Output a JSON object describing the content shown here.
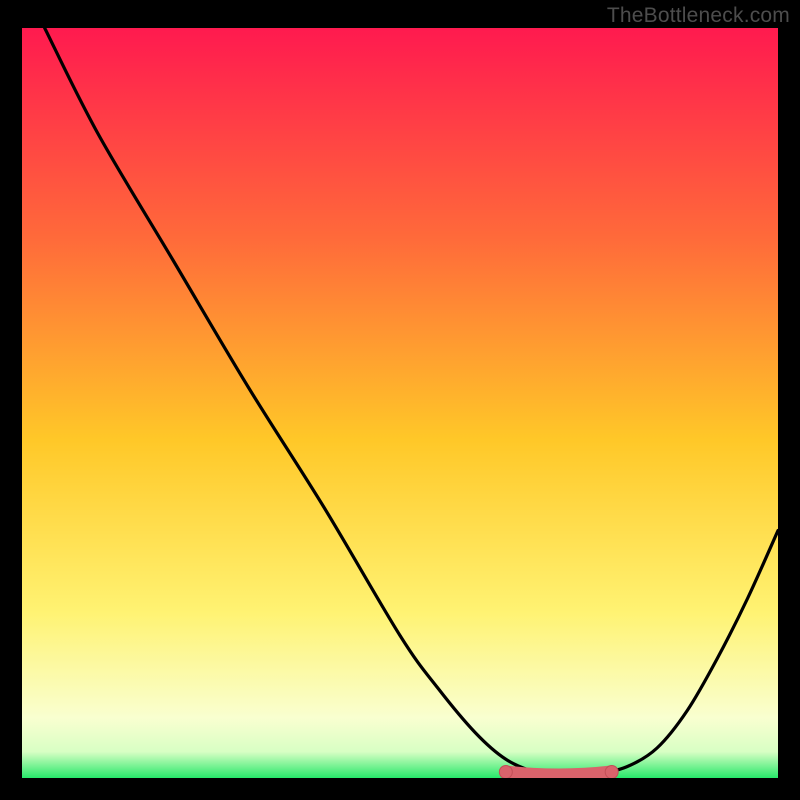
{
  "watermark": "TheBottleneck.com",
  "colors": {
    "black": "#000000",
    "curve": "#000000",
    "marker_fill": "#d9636b",
    "marker_stroke": "#c24f57",
    "grad_top": "#ff1a4f",
    "grad_mid1": "#ff6a3a",
    "grad_mid2": "#ffc828",
    "grad_mid3": "#fff373",
    "grad_mid4": "#f9ffd0",
    "grad_bottom": "#27e86a"
  },
  "chart_data": {
    "type": "line",
    "title": "",
    "xlabel": "",
    "ylabel": "",
    "xlim": [
      0,
      100
    ],
    "ylim": [
      0,
      100
    ],
    "x": [
      3,
      10,
      20,
      30,
      40,
      50,
      55,
      60,
      64,
      68,
      72,
      76,
      80,
      84,
      88,
      92,
      96,
      100
    ],
    "values": [
      100,
      86,
      69,
      52,
      36,
      19,
      12,
      6,
      2.5,
      0.8,
      0.5,
      0.6,
      1.5,
      4,
      9,
      16,
      24,
      33
    ],
    "trough_segment": {
      "x_start": 64,
      "x_end": 78,
      "y": 0.8
    }
  }
}
